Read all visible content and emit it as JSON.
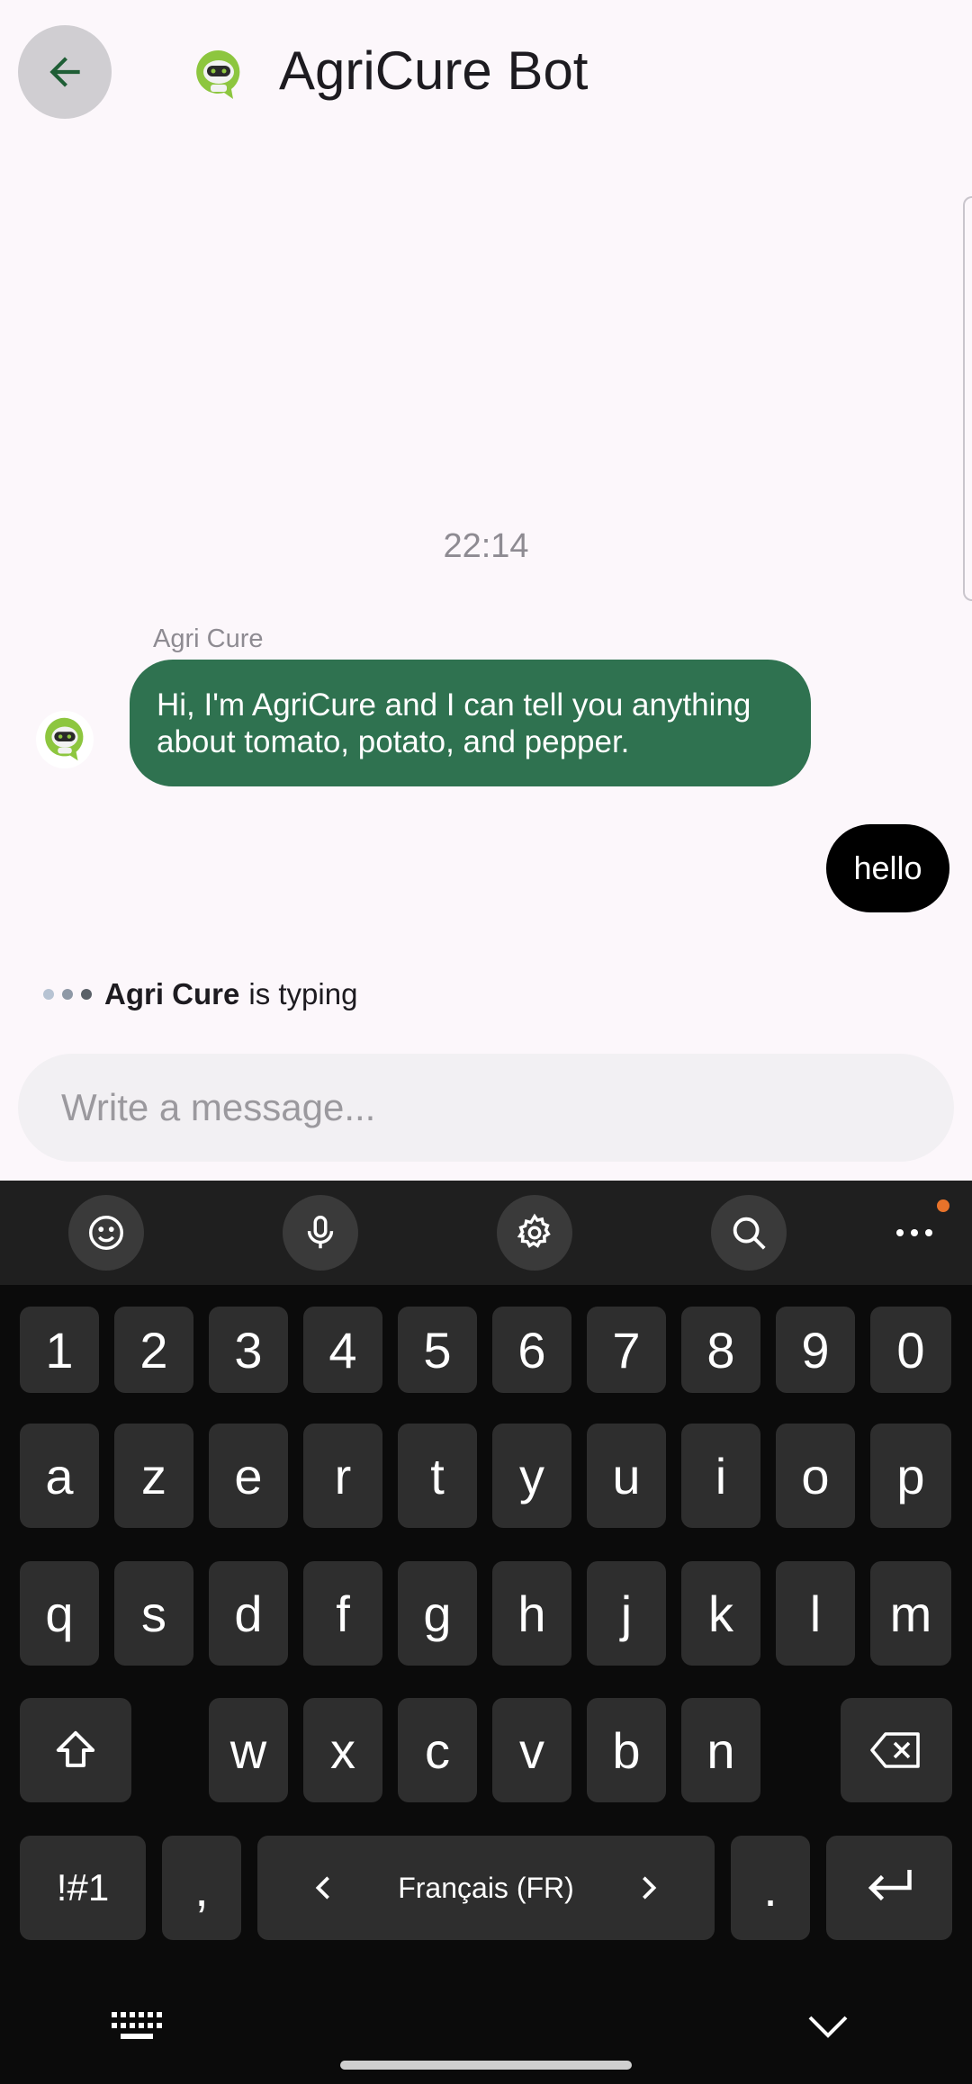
{
  "header": {
    "title": "AgriCure Bot"
  },
  "chat": {
    "timestamp": "22:14",
    "sender_name": "Agri Cure",
    "bot_message": "Hi, I'm AgriCure and I can tell you anything about tomato, potato, and pepper.",
    "user_message": "hello",
    "typing_name": "Agri Cure",
    "typing_suffix": "is typing"
  },
  "input": {
    "placeholder": "Write a message..."
  },
  "keyboard": {
    "row_numbers": [
      "1",
      "2",
      "3",
      "4",
      "5",
      "6",
      "7",
      "8",
      "9",
      "0"
    ],
    "row1": [
      "a",
      "z",
      "e",
      "r",
      "t",
      "y",
      "u",
      "i",
      "o",
      "p"
    ],
    "row2": [
      "q",
      "s",
      "d",
      "f",
      "g",
      "h",
      "j",
      "k",
      "l",
      "m"
    ],
    "row3": [
      "w",
      "x",
      "c",
      "v",
      "b",
      "n"
    ],
    "symbols_label": "!#1",
    "comma_label": ",",
    "period_label": ".",
    "language_label": "Français (FR)"
  },
  "colors": {
    "bot_bubble": "#2f7250",
    "user_bubble": "#000000",
    "accent_green": "#1f5e36",
    "keyboard_bg": "#0b0b0b"
  },
  "icons": [
    "back-arrow-icon",
    "bot-logo-icon",
    "emoji-icon",
    "mic-icon",
    "gear-icon",
    "search-icon",
    "more-icon",
    "shift-icon",
    "backspace-icon",
    "enter-icon",
    "keyboard-icon",
    "chevron-down-icon"
  ]
}
